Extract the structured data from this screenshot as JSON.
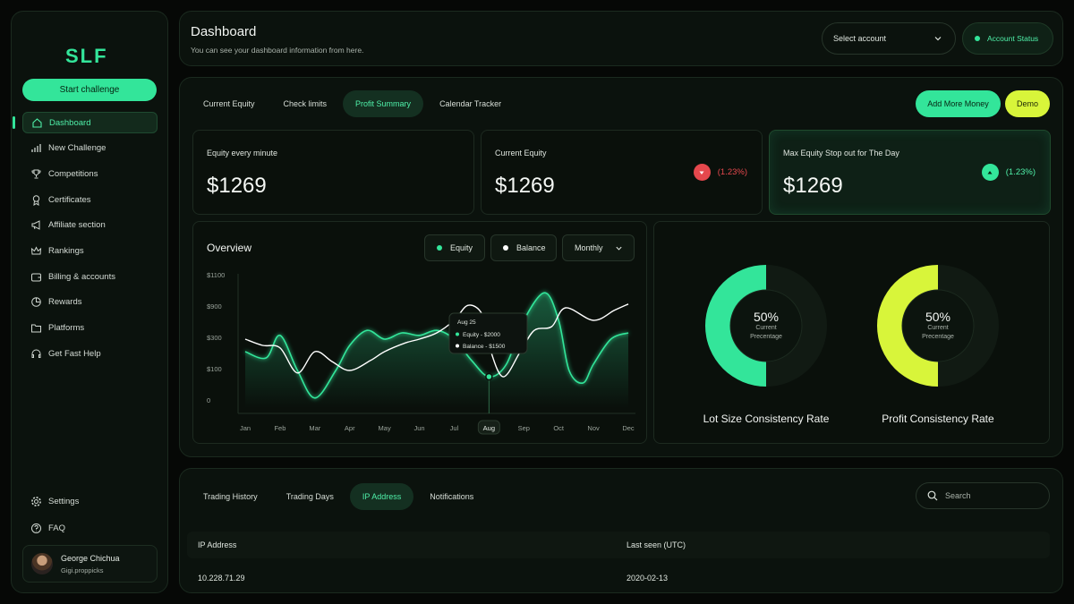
{
  "brand": {
    "logo_text": "SLF",
    "accent": "#33e59a",
    "accent_yellow": "#d8f53a",
    "negative": "#e5484d"
  },
  "sidebar": {
    "start_button": "Start challenge",
    "items": [
      {
        "label": "Dashboard",
        "icon": "home-icon",
        "active": true
      },
      {
        "label": "New Challenge",
        "icon": "bar-chart-icon"
      },
      {
        "label": "Competitions",
        "icon": "trophy-icon"
      },
      {
        "label": "Certificates",
        "icon": "certificate-icon"
      },
      {
        "label": "Affiliate section",
        "icon": "megaphone-icon"
      },
      {
        "label": "Rankings",
        "icon": "crown-icon"
      },
      {
        "label": "Billing & accounts",
        "icon": "wallet-icon"
      },
      {
        "label": "Rewards",
        "icon": "pie-chart-icon"
      },
      {
        "label": "Platforms",
        "icon": "folder-icon"
      },
      {
        "label": "Get Fast Help",
        "icon": "headset-icon"
      }
    ],
    "bottom_items": [
      {
        "label": "Settings",
        "icon": "gear-icon"
      },
      {
        "label": "FAQ",
        "icon": "question-icon"
      }
    ],
    "user": {
      "name": "George Chichua",
      "handle": "Gigi.proppicks"
    }
  },
  "header": {
    "title": "Dashboard",
    "subtitle": "You can see your dashboard information from here.",
    "select_account": "Select account",
    "account_status": "Account Status"
  },
  "main": {
    "tabs": [
      "Current Equity",
      "Check limits",
      "Profit Summary",
      "Calendar Tracker"
    ],
    "active_tab": "Profit Summary",
    "add_money": "Add More Money",
    "demo": "Demo",
    "stats": [
      {
        "label": "Equity every minute",
        "value": "$1269"
      },
      {
        "label": "Current Equity",
        "value": "$1269",
        "change": "(1.23%)",
        "direction": "down"
      },
      {
        "label": "Max Equity Stop out for The Day",
        "value": "$1269",
        "change": "(1.23%)",
        "direction": "up"
      }
    ],
    "overview": {
      "title": "Overview",
      "legend_equity": "Equity",
      "legend_balance": "Balance",
      "period": "Monthly"
    },
    "donuts": [
      {
        "label": "Lot Size Consistency Rate",
        "value": "50%",
        "sub1": "Current",
        "sub2": "Precentage",
        "fraction": 0.5,
        "color": "#33e59a"
      },
      {
        "label": "Profit Consistency Rate",
        "value": "50%",
        "sub1": "Current",
        "sub2": "Precentage",
        "fraction": 0.5,
        "color": "#d8f53a"
      }
    ]
  },
  "chart_data": {
    "type": "line",
    "categories": [
      "Jan",
      "Feb",
      "Mar",
      "Apr",
      "May",
      "Jun",
      "Jul",
      "Aug",
      "Sep",
      "Oct",
      "Nov",
      "Dec"
    ],
    "y_tick_labels": [
      "$1100",
      "$900",
      "$300",
      "$100",
      "0"
    ],
    "highlighted_category": "Aug",
    "tooltip": {
      "title": "Aug 25",
      "equity": "Equity - $2000",
      "balance": "Balance - $1500"
    },
    "series": [
      {
        "name": "Equity",
        "color": "#33e59a",
        "points": [
          [
            0,
            0.45
          ],
          [
            0.6,
            0.4
          ],
          [
            1,
            0.58
          ],
          [
            1.5,
            0.3
          ],
          [
            2,
            0.08
          ],
          [
            2.6,
            0.3
          ],
          [
            3,
            0.5
          ],
          [
            3.5,
            0.62
          ],
          [
            4,
            0.55
          ],
          [
            4.5,
            0.6
          ],
          [
            5,
            0.58
          ],
          [
            5.5,
            0.62
          ],
          [
            6,
            0.55
          ],
          [
            6.5,
            0.38
          ],
          [
            7,
            0.25
          ],
          [
            7.5,
            0.35
          ],
          [
            8,
            0.7
          ],
          [
            8.6,
            0.92
          ],
          [
            9,
            0.7
          ],
          [
            9.3,
            0.3
          ],
          [
            9.7,
            0.2
          ],
          [
            10,
            0.35
          ],
          [
            10.5,
            0.55
          ],
          [
            11,
            0.6
          ]
        ]
      },
      {
        "name": "Balance",
        "color": "#ffffff",
        "points": [
          [
            0,
            0.55
          ],
          [
            0.5,
            0.5
          ],
          [
            1,
            0.48
          ],
          [
            1.5,
            0.28
          ],
          [
            2,
            0.45
          ],
          [
            2.5,
            0.37
          ],
          [
            3,
            0.3
          ],
          [
            3.6,
            0.38
          ],
          [
            4,
            0.45
          ],
          [
            4.6,
            0.52
          ],
          [
            5,
            0.55
          ],
          [
            5.5,
            0.6
          ],
          [
            6,
            0.7
          ],
          [
            6.4,
            0.82
          ],
          [
            6.8,
            0.75
          ],
          [
            7,
            0.5
          ],
          [
            7.4,
            0.25
          ],
          [
            7.9,
            0.45
          ],
          [
            8.3,
            0.62
          ],
          [
            8.8,
            0.65
          ],
          [
            9.2,
            0.8
          ],
          [
            10,
            0.7
          ],
          [
            10.6,
            0.78
          ],
          [
            11,
            0.83
          ]
        ]
      }
    ]
  },
  "bottom": {
    "tabs": [
      "Trading History",
      "Trading Days",
      "IP Address",
      "Notifications"
    ],
    "active_tab": "IP Address",
    "search_placeholder": "Search",
    "columns": [
      "IP Address",
      "Last seen (UTC)"
    ],
    "rows": [
      [
        "10.228.71.29",
        "2020-02-13"
      ]
    ]
  }
}
